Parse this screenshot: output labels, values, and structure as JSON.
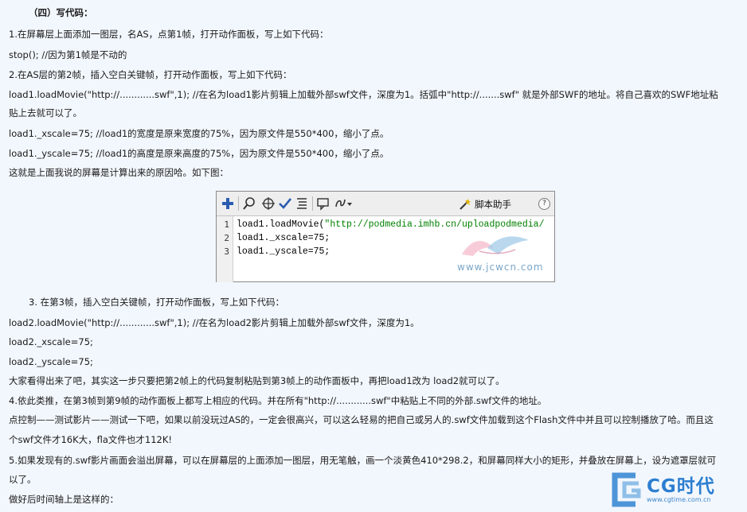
{
  "heading": "（四）写代码：",
  "lines": [
    "1.在屏幕层上面添加一图层，名AS，点第1帧，打开动作面板，写上如下代码：",
    "stop(); //因为第1帧是不动的",
    "2.在AS层的第2帧，插入空白关键帧，打开动作面板，写上如下代码：",
    "load1.loadMovie(\"http://............swf\",1); //在名为load1影片剪辑上加载外部swf文件，深度为1。括弧中\"http://.......swf\" 就是外部SWF的地址。将自己喜欢的SWF地址粘",
    "贴上去就可以了。",
    "load1._xscale=75; //load1的宽度是原来宽度的75%，因为原文件是550*400，缩小了点。",
    "load1._yscale=75; //load1的高度是原来高度的75%，因为原文件是550*400，缩小了点。",
    "这就是上面我说的屏幕是计算出来的原因哈。如下图："
  ],
  "panel": {
    "assist_label": "脚本助手",
    "help_glyph": "?",
    "line_numbers": [
      "1",
      "2",
      "3"
    ],
    "code1_pre": "load1.loadMovie(",
    "code1_str": "\"http://podmedia.imhb.cn/uploadpodmedia/",
    "code2": "load1._xscale=75;",
    "code3": "load1._yscale=75;",
    "watermark": "www.jcwcn.com"
  },
  "lines2": [
    "3. 在第3帧，插入空白关键帧，打开动作面板，写上如下代码：",
    "load2.loadMovie(\"http://............swf\",1); //在名为load2影片剪辑上加载外部swf文件，深度为1。",
    "load2._xscale=75;",
    "load2._yscale=75;",
    "大家看得出来了吧，其实这一步只要把第2帧上的代码复制粘贴到第3帧上的动作面板中，再把load1改为 load2就可以了。",
    "4.依此类推，在第3帧到第9帧的动作面板上都写上相应的代码。并在所有\"http://............swf\"中粘贴上不同的外部.swf文件的地址。",
    "点控制——测试影片——测试一下吧，如果以前没玩过AS的，一定会很高兴，可以这么轻易的把自己或另人的.swf文件加载到这个Flash文件中并且可以控制播放了哈。而且这",
    "个swf文件才16K大，fla文件也才112K!",
    "5.如果发现有的.swf影片画面会溢出屏幕，可以在屏幕层的上面添加一图层，用无笔触，画一个淡黄色410*298.2，和屏幕同样大小的矩形，并叠放在屏幕上，设为遮罩层就可",
    "以了。",
    "做好后时间轴上是这样的："
  ],
  "logo": {
    "text": "CG时代",
    "url": "www.cgtime.com.cn"
  }
}
